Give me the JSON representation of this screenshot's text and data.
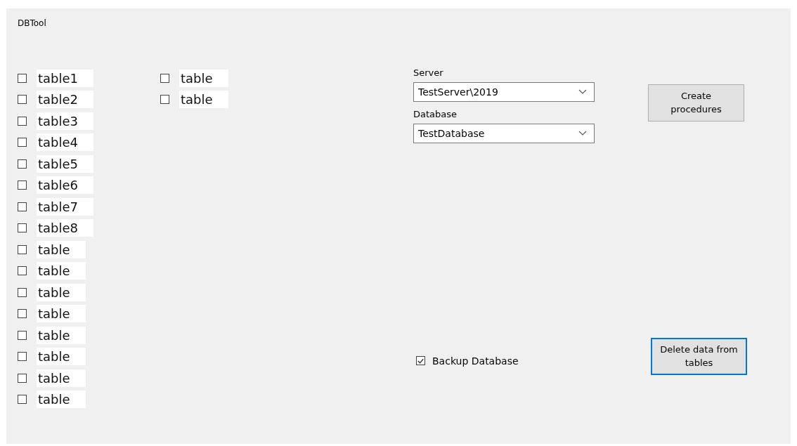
{
  "window": {
    "title": "DBTool"
  },
  "table_columns": [
    [
      {
        "label": "table1",
        "checked": false
      },
      {
        "label": "table2",
        "checked": false
      },
      {
        "label": "table3",
        "checked": false
      },
      {
        "label": "table4",
        "checked": false
      },
      {
        "label": "table5",
        "checked": false
      },
      {
        "label": "table6",
        "checked": false
      },
      {
        "label": "table7",
        "checked": false
      },
      {
        "label": "table8",
        "checked": false
      },
      {
        "label": "table",
        "checked": false
      },
      {
        "label": "table",
        "checked": false
      },
      {
        "label": "table",
        "checked": false
      },
      {
        "label": "table",
        "checked": false
      },
      {
        "label": "table",
        "checked": false
      },
      {
        "label": "table",
        "checked": false
      },
      {
        "label": "table",
        "checked": false
      },
      {
        "label": "table",
        "checked": false
      }
    ],
    [
      {
        "label": "table",
        "checked": false
      },
      {
        "label": "table",
        "checked": false
      }
    ]
  ],
  "server": {
    "label": "Server",
    "value": "TestServer\\2019"
  },
  "database": {
    "label": "Database",
    "value": "TestDatabase"
  },
  "create_button": {
    "label": "Create procedures",
    "focused": false
  },
  "backup": {
    "label": "Backup Database",
    "checked": true
  },
  "delete_button": {
    "label": "Delete data from tables",
    "focused": true
  }
}
